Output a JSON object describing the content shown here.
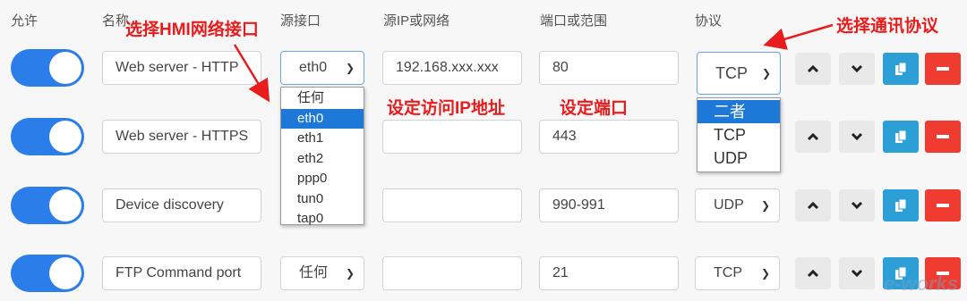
{
  "headers": {
    "enable": "允许",
    "name": "名称",
    "src_iface": "源接口",
    "src_ip": "源IP或网络",
    "port": "端口或范围",
    "protocol": "协议"
  },
  "rows": [
    {
      "enabled": true,
      "name": "Web server - HTTP",
      "iface": "eth0",
      "ip": "192.168.xxx.xxx",
      "port": "80",
      "protocol": "TCP"
    },
    {
      "enabled": true,
      "name": "Web server - HTTPS",
      "iface": "",
      "ip": "",
      "port": "443",
      "protocol": ""
    },
    {
      "enabled": true,
      "name": "Device discovery",
      "iface": "",
      "ip": "",
      "port": "990-991",
      "protocol": "UDP"
    },
    {
      "enabled": true,
      "name": "FTP Command port",
      "iface": "任何",
      "ip": "",
      "port": "21",
      "protocol": "TCP"
    }
  ],
  "iface_options": [
    "任何",
    "eth0",
    "eth1",
    "eth2",
    "ppp0",
    "tun0",
    "tap0"
  ],
  "iface_selected": "eth0",
  "protocol_options": [
    "二者",
    "TCP",
    "UDP"
  ],
  "protocol_highlighted": "二者",
  "annotations": {
    "choose_iface": "选择HMI网络接口",
    "choose_protocol": "选择通讯协议",
    "set_ip": "设定访问IP地址",
    "set_port": "设定端口"
  },
  "watermark": "e-works",
  "colors": {
    "toggle": "#2b7de9",
    "accent_blue": "#2c9fd6",
    "danger": "#f03b30",
    "annotation": "#e81c1c",
    "selected": "#1e78d8"
  }
}
